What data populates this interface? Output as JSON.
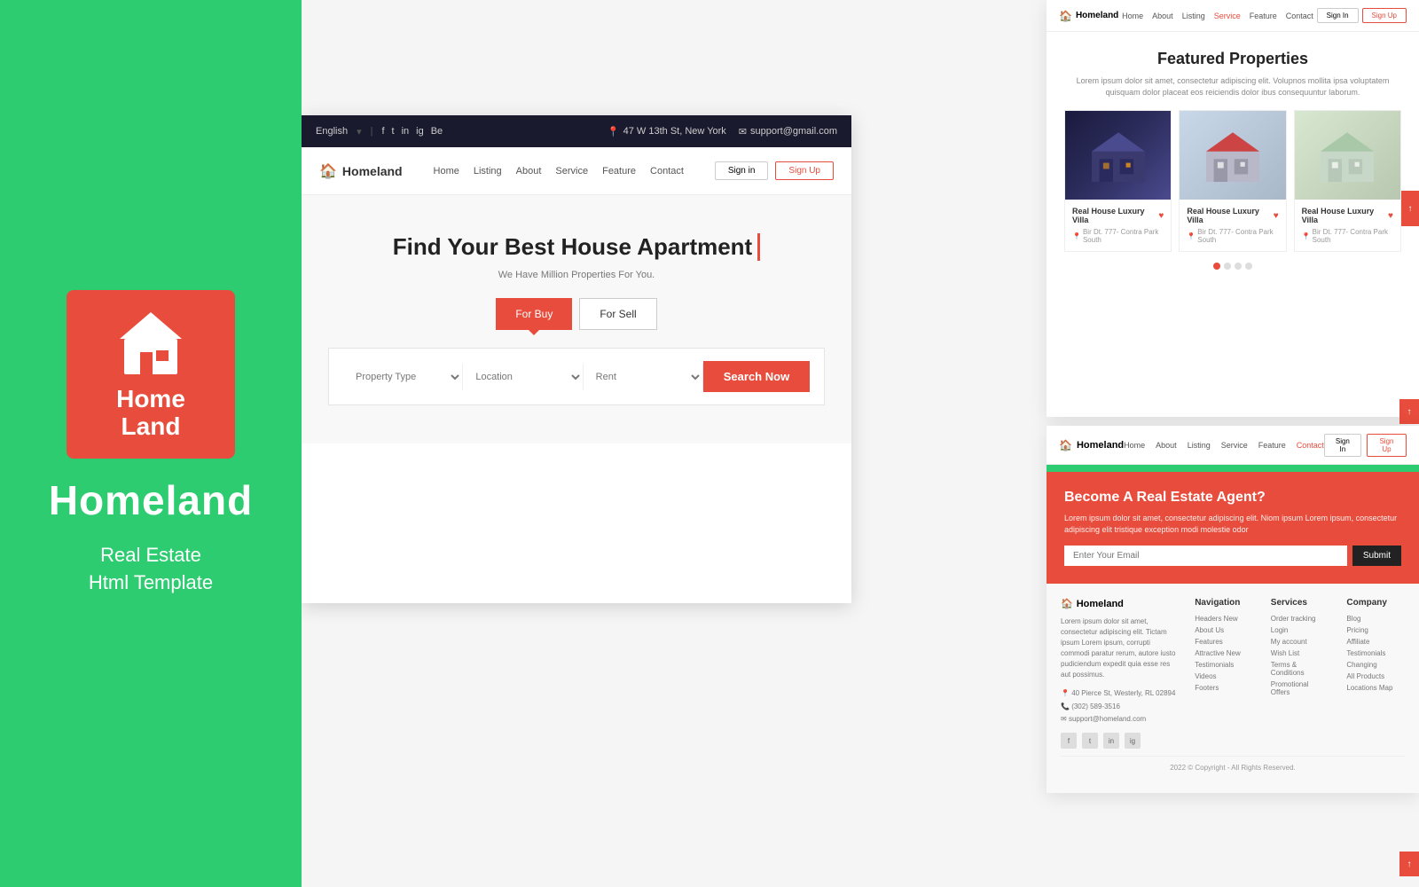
{
  "left_panel": {
    "logo_text_line1": "Home",
    "logo_text_line2": "Land",
    "brand_name": "Homeland",
    "subtitle_line1": "Real Estate",
    "subtitle_line2": "Html Template"
  },
  "topbar": {
    "language": "English",
    "social_icons": [
      "f",
      "t",
      "in",
      "ig",
      "be"
    ],
    "address": "47 W 13th St, New York",
    "email": "support@gmail.com"
  },
  "navbar": {
    "logo_text": "Homeland",
    "links": [
      "Home",
      "Listing",
      "About",
      "Service",
      "Feature",
      "Contact"
    ],
    "btn_signin": "Sign in",
    "btn_signup": "Sign Up"
  },
  "hero": {
    "title": "Find Your Best House Apartment",
    "subtitle": "We Have Million Properties For You.",
    "btn_buy": "For Buy",
    "btn_sell": "For Sell"
  },
  "search": {
    "property_type_label": "Property Type",
    "location_label": "Location",
    "rent_label": "Rent",
    "btn_label": "Search Now"
  },
  "featured": {
    "section_title": "Featured Properties",
    "description": "Lorem ipsum dolor sit amet, consectetur adipiscing elit. Volupnos mollita ipsa voluptatem quisquam dolor placeat eos reiciendis dolor ibus consequuntur laborum.",
    "properties": [
      {
        "name": "Real House Luxury Villa",
        "location": "Bir Dt. 777- Contra Park South"
      },
      {
        "name": "Real House Luxury Villa",
        "location": "Bir Dt. 777- Contra Park South"
      },
      {
        "name": "Real House Luxury Villa",
        "location": "Bir Dt. 777- Contra Park South"
      }
    ]
  },
  "agent": {
    "title": "Become A Real Estate Agent?",
    "description": "Lorem ipsum dolor sit amet, consectetur adipiscing elit. Niom ipsum Lorem ipsum, consectetur adipiscing elit tristique exception modi molestie odor",
    "email_placeholder": "Enter Your Email",
    "btn_submit": "Submit"
  },
  "footer": {
    "brand": "Homeland",
    "brand_desc": "Lorem ipsum dolor sit amet, consectetur adipiscing elit. Tictam ipsum Lorem ipsum, corrupti commodi paratur rerum, autore iusto pudiciendum expedit quia esse res aut possimus.",
    "address": "40 Pierce St, Westerly, RL 02894",
    "phone": "(302) 589-3516",
    "email": "support@homeland.com",
    "nav_col": {
      "title": "Navigation",
      "links": [
        "Headers New",
        "About Us",
        "Features",
        "Attractive New",
        "Testimonials",
        "Videos",
        "Footers"
      ]
    },
    "services_col": {
      "title": "Services",
      "links": [
        "Order tracking",
        "Login",
        "My account",
        "Wish List",
        "Terms & Conditions",
        "Promotional Offers"
      ]
    },
    "company_col": {
      "title": "Company",
      "links": [
        "Blog",
        "Pricing",
        "Affiliate",
        "Testimonials",
        "Changing",
        "All Products",
        "Locations Map"
      ]
    },
    "copyright": "2022 © Copyright - All Rights Reserved."
  },
  "featured_nav": {
    "logo": "Homeland",
    "links": [
      "Home",
      "About",
      "Listing",
      "Service",
      "Feature",
      "Contact"
    ],
    "btn_signin": "Sign In",
    "btn_signup": "Sign Up",
    "active_link": "Service"
  },
  "bottom_nav": {
    "logo": "Homeland",
    "links": [
      "Home",
      "About",
      "Listing",
      "Service",
      "Feature",
      "Contact"
    ],
    "btn_signin": "Sign In",
    "btn_signup": "Sign Up",
    "active_link": "Contact"
  }
}
